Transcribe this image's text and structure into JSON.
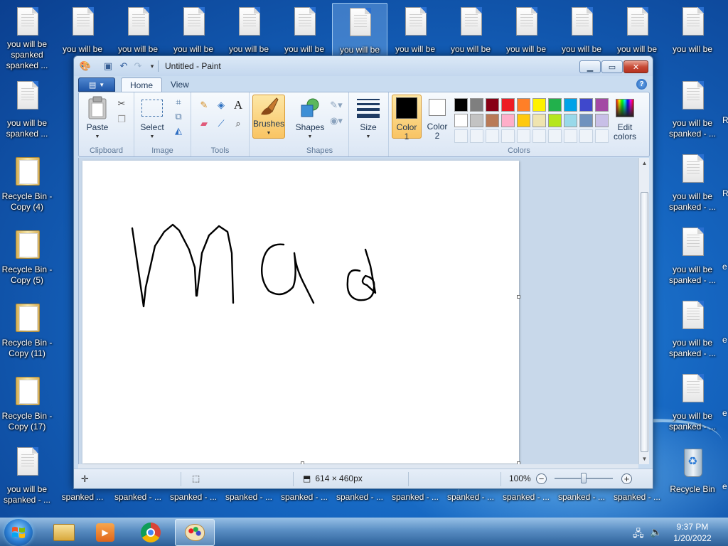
{
  "desktop": {
    "top_row_labels": [
      "you will be spanked",
      "you will be",
      "you will be",
      "you will be",
      "you will be",
      "you will be",
      "you will be",
      "you will be",
      "you will be",
      "you will be",
      "you will be",
      "you will be",
      "you will be"
    ],
    "top_row_first_subtext": "spanked ...",
    "left_column": [
      {
        "label": "you will be spanked ...",
        "icon": "text-document-icon"
      },
      {
        "label": "Recycle Bin - Copy (4)",
        "icon": "folder-icon"
      },
      {
        "label": "Recycle Bin - Copy (5)",
        "icon": "folder-icon"
      },
      {
        "label": "Recycle Bin - Copy (11)",
        "icon": "folder-icon"
      },
      {
        "label": "Recycle Bin - Copy (17)",
        "icon": "folder-icon"
      },
      {
        "label": "you will be spanked - ...",
        "icon": "text-document-icon"
      }
    ],
    "right_column": [
      {
        "label": "you will be spanked - ...",
        "icon": "text-document-icon"
      },
      {
        "label": "you will be spanked - ...",
        "icon": "text-document-icon"
      },
      {
        "label": "you will be spanked - ...",
        "icon": "text-document-icon"
      },
      {
        "label": "you will be spanked - ...",
        "icon": "text-document-icon"
      },
      {
        "label": "you will be spanked - ...",
        "icon": "text-document-icon"
      },
      {
        "label": "Recycle Bin",
        "icon": "recycle-bin-icon"
      }
    ],
    "bottom_row_labels": [
      "spanked ...",
      "spanked - ...",
      "spanked - ...",
      "spanked - ...",
      "spanked - ...",
      "spanked - ...",
      "spanked - ...",
      "spanked - ...",
      "spanked - ...",
      "spanked - ...",
      "spanked - ..."
    ],
    "partial_right_labels": [
      "R",
      "R",
      "e",
      "e",
      "e",
      "e"
    ]
  },
  "paint": {
    "title": "Untitled - Paint",
    "tabs": [
      "Home",
      "View"
    ],
    "active_tab": "Home",
    "groups": {
      "clipboard": {
        "label": "Clipboard",
        "paste": "Paste"
      },
      "image": {
        "label": "Image",
        "select": "Select"
      },
      "tools": {
        "label": "Tools"
      },
      "brushes": {
        "label": "Brushes"
      },
      "shapes": {
        "label": "Shapes",
        "shapes_btn": "Shapes"
      },
      "size": {
        "label": "Size"
      },
      "colors": {
        "label": "Colors",
        "color1": "Color\n1",
        "color1_line1": "Color",
        "color1_line2": "1",
        "color2_line1": "Color",
        "color2_line2": "2",
        "edit_line1": "Edit",
        "edit_line2": "colors",
        "color1_value": "#000000",
        "color2_value": "#ffffff",
        "palette_row1": [
          "#000000",
          "#7f7f7f",
          "#880015",
          "#ed1c24",
          "#ff7f27",
          "#fff200",
          "#22b14c",
          "#00a2e8",
          "#3f48cc",
          "#a349a4"
        ],
        "palette_row2": [
          "#ffffff",
          "#c3c3c3",
          "#b97a57",
          "#ffaec9",
          "#ffc90e",
          "#efe4b0",
          "#b5e61d",
          "#99d9ea",
          "#7092be",
          "#c8bfe7"
        ]
      }
    },
    "canvas_text": "Mad",
    "status": {
      "dimensions": "614 × 460px",
      "zoom": "100%",
      "zoom_fraction": 0.5
    }
  },
  "taskbar": {
    "time": "9:37 PM",
    "date": "1/20/2022",
    "items": [
      "file-explorer-icon",
      "media-player-icon",
      "chrome-icon",
      "paint-icon"
    ],
    "active_item": "paint-icon"
  }
}
